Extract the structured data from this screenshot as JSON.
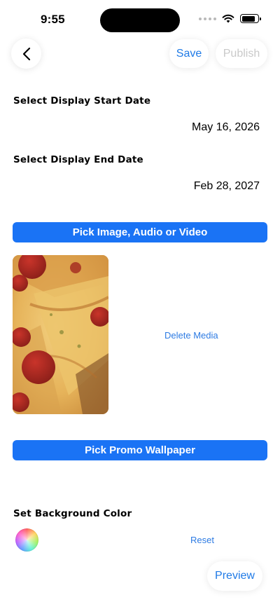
{
  "status_bar": {
    "time": "9:55",
    "battery_level": 0.85
  },
  "nav": {
    "back_icon": "chevron-left-icon",
    "save_label": "Save",
    "publish_label": "Publish"
  },
  "start_date": {
    "label": "Select Display Start Date",
    "value": "May 16, 2026"
  },
  "end_date": {
    "label": "Select Display End Date",
    "value": "Feb 28, 2027"
  },
  "media": {
    "pick_label": "Pick Image, Audio or Video",
    "delete_label": "Delete Media"
  },
  "wallpaper": {
    "pick_label": "Pick Promo Wallpaper"
  },
  "background": {
    "label": "Set Background Color",
    "reset_label": "Reset"
  },
  "preview_label": "Preview",
  "colors": {
    "accent": "#1a73f5",
    "link": "#2d7be3",
    "disabled": "#c9c9c9"
  }
}
